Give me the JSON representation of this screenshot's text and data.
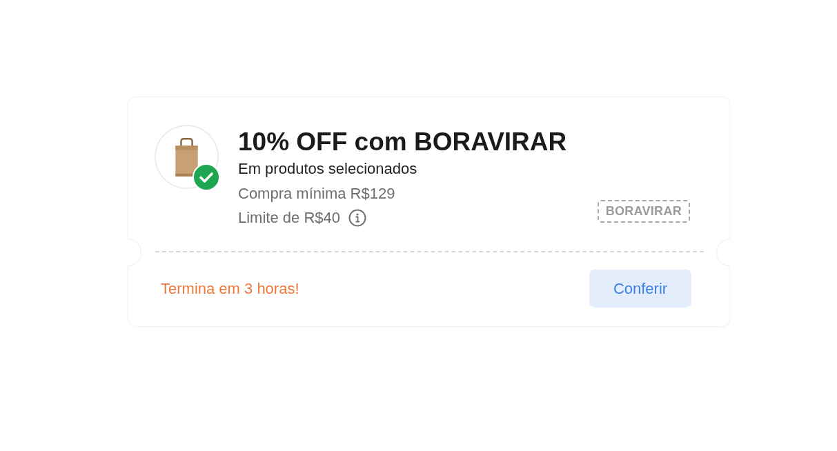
{
  "coupon": {
    "image": {
      "verified": true
    },
    "title": "10% OFF com BORAVIRAR",
    "subtitle": "Em produtos selecionados",
    "minimum_purchase": "Compra mínima R$129",
    "limit": "Limite de R$40",
    "code": "BORAVIRAR",
    "expiry": "Termina em 3 horas!",
    "button": "Conferir"
  }
}
